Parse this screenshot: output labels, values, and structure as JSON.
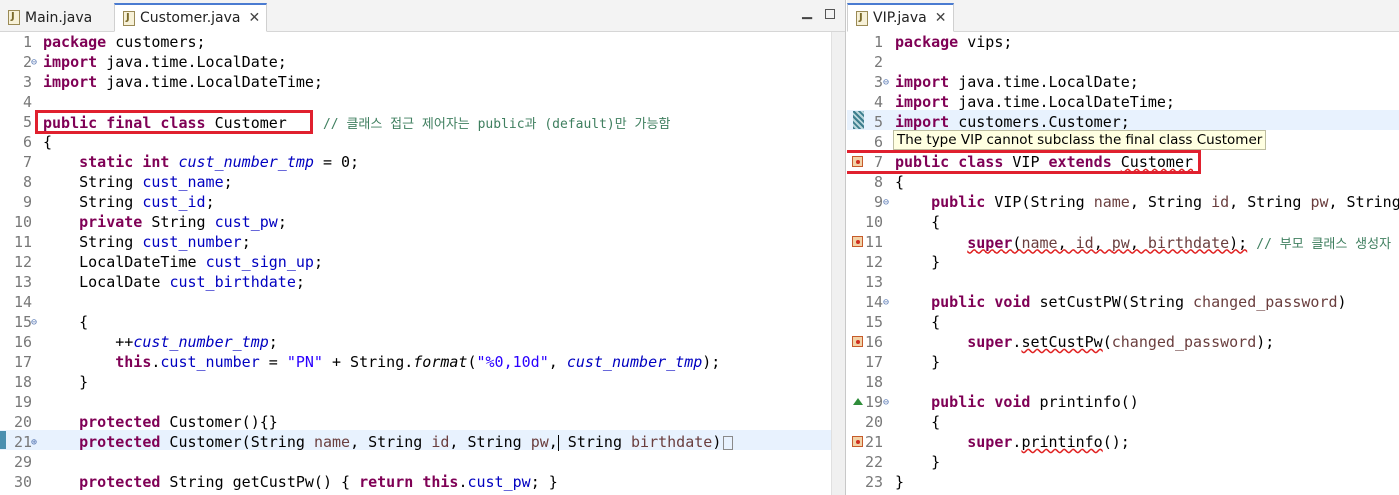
{
  "left": {
    "tabs": [
      {
        "label": "Main.java",
        "active": false
      },
      {
        "label": "Customer.java",
        "active": true
      }
    ],
    "comment_line5": "// 클래스 접근 제어자는 public과 (default)만 가능함",
    "lines": [
      "1",
      "2",
      "3",
      "4",
      "5",
      "6",
      "7",
      "8",
      "9",
      "10",
      "11",
      "12",
      "13",
      "14",
      "15",
      "16",
      "17",
      "18",
      "19",
      "20",
      "21",
      "29",
      "30"
    ]
  },
  "right": {
    "tabs": [
      {
        "label": "VIP.java",
        "active": true
      }
    ],
    "tooltip": "The type VIP cannot subclass the final class Customer",
    "comment_line11": "// 부모 클래스 생성자",
    "lines": [
      "1",
      "2",
      "3",
      "4",
      "5",
      "6",
      "7",
      "8",
      "9",
      "10",
      "11",
      "12",
      "13",
      "14",
      "15",
      "16",
      "17",
      "18",
      "19",
      "20",
      "21",
      "22",
      "23"
    ]
  },
  "colors": {
    "keyword": "#7f0055",
    "field": "#0000c0",
    "string": "#2a00ff",
    "comment": "#3f7f5f",
    "highlight_box": "#e0202e"
  },
  "icons": [
    "java-file-icon",
    "close-icon",
    "minimize-icon",
    "maximize-icon",
    "fold-collapse-icon",
    "fold-expand-icon",
    "error-marker-icon",
    "override-marker-icon"
  ]
}
